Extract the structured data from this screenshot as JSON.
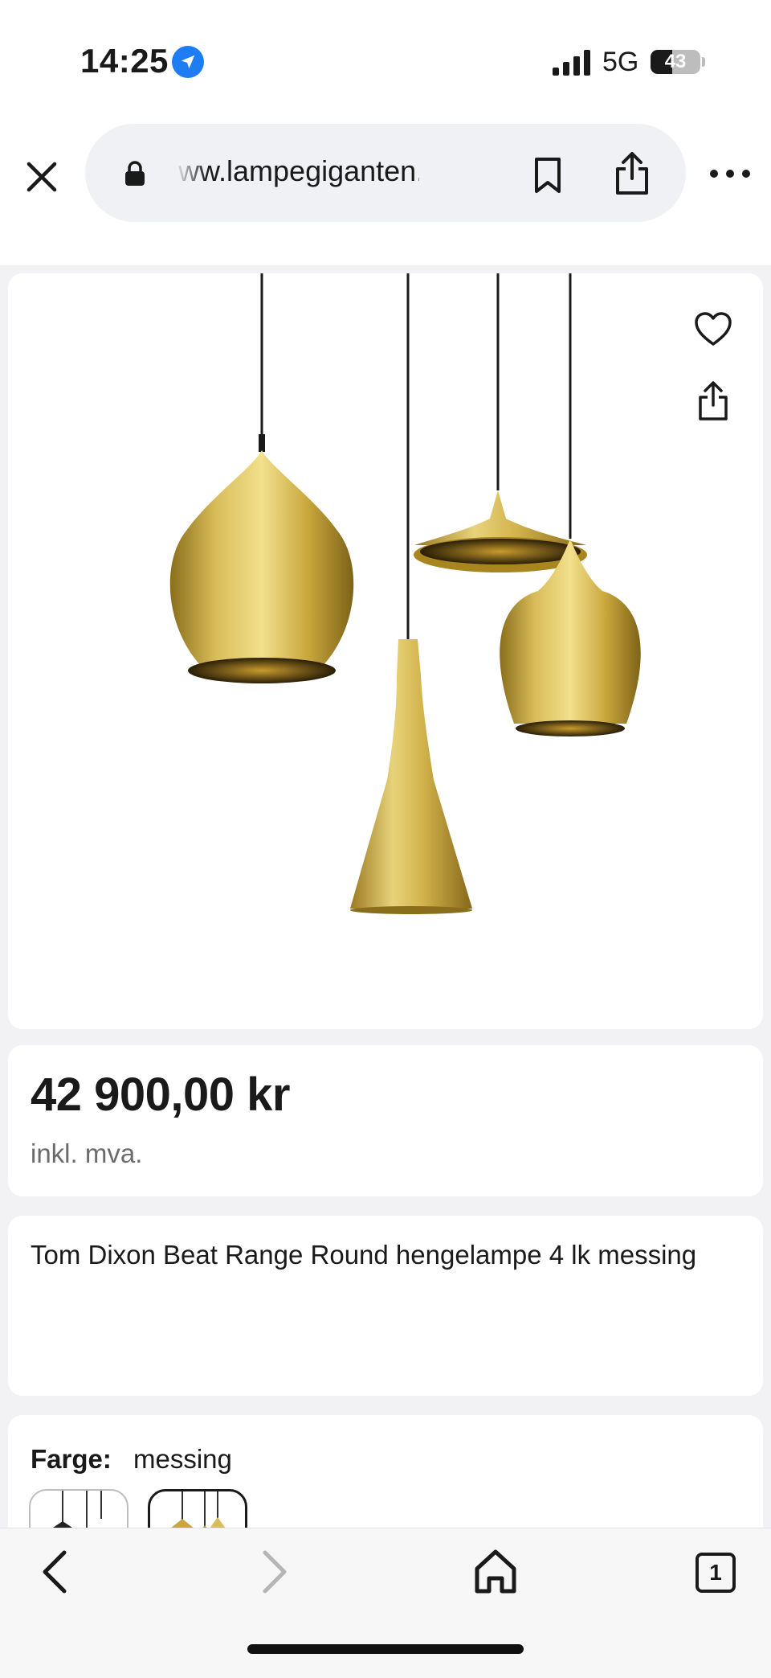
{
  "status_bar": {
    "time": "14:25",
    "network": "5G",
    "battery_level": "43",
    "battery_fraction": 0.43
  },
  "browser": {
    "url": "ww.lampegiganten.no",
    "tab_count": "1"
  },
  "product": {
    "price": "42 900,00 kr",
    "vat_note": "inkl. mva.",
    "title": "Tom Dixon Beat Range Round hengelampe 4 lk messing",
    "color_label": "Farge:",
    "color_value": "messing"
  },
  "colors": {
    "accent": "#1e7cf5",
    "brass": "#c9a73d",
    "text": "#1a1a1a",
    "muted": "#6b6b6b"
  },
  "icons": [
    "location-arrow-icon",
    "signal-icon",
    "battery-icon",
    "close-icon",
    "lock-icon",
    "bookmark-icon",
    "share-icon",
    "more-icon",
    "heart-icon",
    "back-icon",
    "forward-icon",
    "home-icon",
    "tabs-icon"
  ]
}
